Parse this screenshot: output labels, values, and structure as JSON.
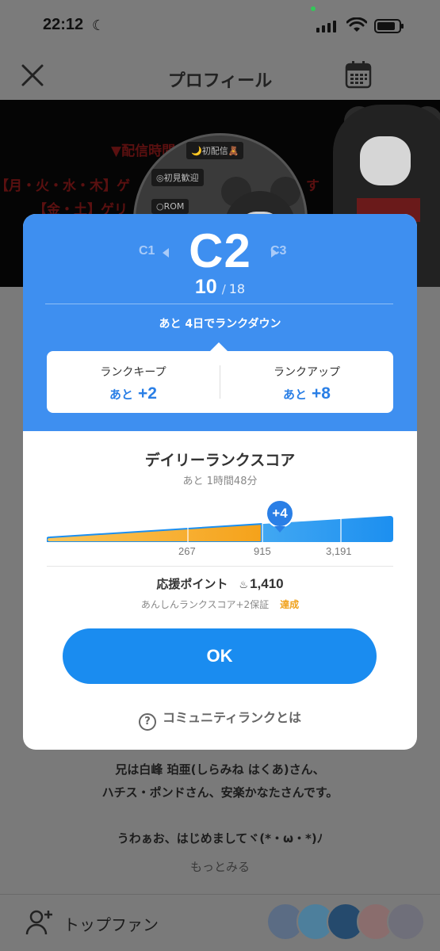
{
  "status_bar": {
    "time": "22:12"
  },
  "nav": {
    "title": "プロフィール"
  },
  "banner": {
    "lines": [
      "▼配信時間",
      "【月・火・水・木】ゲ",
      "す",
      "【金・土】ゲリ"
    ],
    "tags": [
      "🌙初配信🧸",
      "◎初見歓迎",
      "○ROM"
    ]
  },
  "rank_modal": {
    "prev_rank": "C1",
    "current_rank": "C2",
    "next_rank": "C3",
    "count_current": "10",
    "count_separator": "/",
    "count_total": "18",
    "notice": "あと 4日でランクダウン",
    "keep": {
      "title": "ランクキープ",
      "prefix": "あと",
      "value": "+2"
    },
    "up": {
      "title": "ランクアップ",
      "prefix": "あと",
      "value": "+8"
    },
    "daily_title": "デイリーランクスコア",
    "daily_remaining": "あと 1時間48分",
    "score_badge": "+4",
    "ticks": [
      "267",
      "915",
      "3,191"
    ],
    "score_fill_fraction": 0.62,
    "support_label": "応援ポイント",
    "support_points": "1,410",
    "guarantee": "あんしんランクスコア+2保証",
    "achieved": "達成",
    "ok_label": "OK",
    "help_label": "コミュニティランクとは"
  },
  "profile_text": {
    "line1": "兄は白峰 珀亜(しらみね はくあ)さん、",
    "line2": "ハチス・ポンドさん、安楽かなたさんです。",
    "line3": "うわぁお、はじめましてヾ(*・ω・*)ﾉ",
    "more": "もっとみる"
  },
  "top_fan": {
    "label": "トップファン"
  },
  "colors": {
    "accent": "#3e8ff0",
    "button": "#1a8cf0",
    "bar_fill": "#f5a623",
    "achieved": "#f0a21d"
  }
}
